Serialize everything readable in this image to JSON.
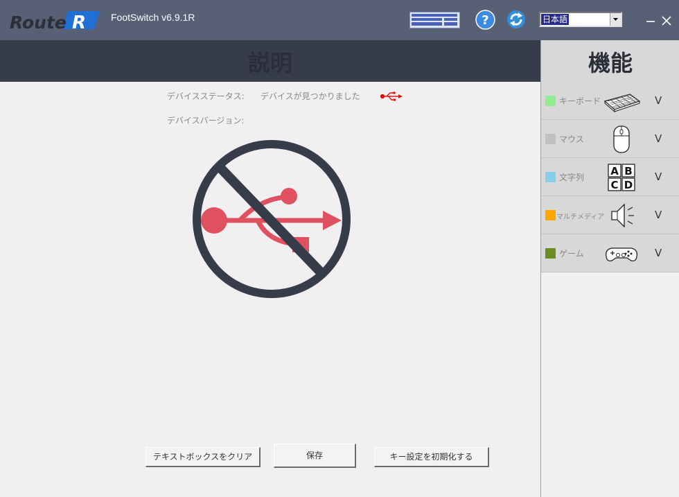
{
  "app": {
    "title": "FootSwitch v6.9.1R",
    "language": "日本語"
  },
  "main": {
    "header": "説明",
    "device_status_label": "デバイスステータス:",
    "device_status_value": "デバイスが見つかりました",
    "device_version_label": "デバイスバージョン:",
    "buttons": {
      "clear": "テキストボックスをクリア",
      "save": "保存",
      "reset": "キー設定を初期化する"
    }
  },
  "side": {
    "header": "機能",
    "items": [
      {
        "label": "キーボード",
        "color": "#90ee90",
        "icon": "keyboard-icon"
      },
      {
        "label": "マウス",
        "color": "#c0c0c0",
        "icon": "mouse-icon"
      },
      {
        "label": "文字列",
        "color": "#87ceeb",
        "icon": "string-abcd-icon"
      },
      {
        "label": "マルチメディア",
        "color": "#ffa500",
        "icon": "speaker-icon"
      },
      {
        "label": "ゲーム",
        "color": "#6b8e23",
        "icon": "gamepad-icon"
      }
    ],
    "chevron": "V"
  },
  "colors": {
    "titlebar": "#586075",
    "header_dark": "#373c4b",
    "usb_red": "#e0515f",
    "ring": "#373c4b"
  }
}
